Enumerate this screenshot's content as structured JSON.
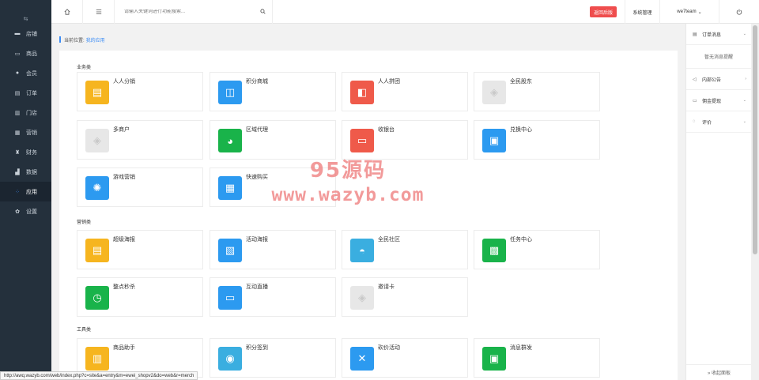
{
  "sidebar": {
    "collapse_icon": "collapse-icon",
    "items": [
      {
        "label": "店铺",
        "icon": "store-icon"
      },
      {
        "label": "商品",
        "icon": "goods-icon"
      },
      {
        "label": "会员",
        "icon": "member-icon"
      },
      {
        "label": "订单",
        "icon": "order-icon"
      },
      {
        "label": "门店",
        "icon": "shop-icon"
      },
      {
        "label": "营销",
        "icon": "marketing-icon"
      },
      {
        "label": "财务",
        "icon": "finance-icon"
      },
      {
        "label": "数据",
        "icon": "data-icon"
      },
      {
        "label": "应用",
        "icon": "apps-icon",
        "active": true
      },
      {
        "label": "设置",
        "icon": "settings-icon"
      }
    ]
  },
  "header": {
    "search_placeholder": "请输入关键词进行功能搜索...",
    "back_label": "返回后版",
    "system_label": "系统管理",
    "user_label": "we7team",
    "user_arrow": "⌄"
  },
  "breadcrumb": {
    "prefix": "当前位置:",
    "current": "我的应用"
  },
  "sections": [
    {
      "title": "业务类",
      "cards": [
        {
          "label": "人人分销",
          "color": "#f6b51f",
          "glyph": "▤"
        },
        {
          "label": "积分商城",
          "color": "#2c9af0",
          "glyph": "◫"
        },
        {
          "label": "人人拼团",
          "color": "#ef5a4a",
          "glyph": "◧"
        },
        {
          "label": "全民股东",
          "color": "#e7e7e7",
          "glyph": "◈"
        },
        {
          "label": "多商户",
          "color": "#e7e7e7",
          "glyph": "◈"
        },
        {
          "label": "区域代理",
          "color": "#19b34a",
          "glyph": "◕"
        },
        {
          "label": "收银台",
          "color": "#ef5a4a",
          "glyph": "▭"
        },
        {
          "label": "兑换中心",
          "color": "#2c9af0",
          "glyph": "▣"
        },
        {
          "label": "游戏营销",
          "color": "#2c9af0",
          "glyph": "✺"
        },
        {
          "label": "快速购买",
          "color": "#2c9af0",
          "glyph": "▦"
        }
      ]
    },
    {
      "title": "营销类",
      "cards": [
        {
          "label": "超级海报",
          "color": "#f6b51f",
          "glyph": "▤"
        },
        {
          "label": "活动海报",
          "color": "#2c9af0",
          "glyph": "▧"
        },
        {
          "label": "全民社区",
          "color": "#3aaee0",
          "glyph": "◓"
        },
        {
          "label": "任务中心",
          "color": "#19b34a",
          "glyph": "▩"
        },
        {
          "label": "整点秒杀",
          "color": "#19b34a",
          "glyph": "◷"
        },
        {
          "label": "互动直播",
          "color": "#2c9af0",
          "glyph": "▭"
        },
        {
          "label": "邀请卡",
          "color": "#e7e7e7",
          "glyph": "◈"
        }
      ]
    },
    {
      "title": "工具类",
      "cards": [
        {
          "label": "商品助手",
          "color": "#f6b51f",
          "glyph": "▥"
        },
        {
          "label": "积分签到",
          "color": "#3aaee0",
          "glyph": "◉"
        },
        {
          "label": "砍价活动",
          "color": "#2c9af0",
          "glyph": "✕"
        },
        {
          "label": "消息群发",
          "color": "#19b34a",
          "glyph": "▣"
        }
      ]
    }
  ],
  "right_panel": {
    "items": [
      {
        "label": "订单消息",
        "icon": "order-message-icon",
        "arrow": "⌄"
      },
      {
        "label": "内部公告",
        "icon": "announcement-icon",
        "arrow": "›"
      },
      {
        "label": "佣金提现",
        "icon": "withdraw-icon",
        "arrow": "⌄"
      },
      {
        "label": "评价",
        "icon": "review-icon",
        "arrow": "⌄"
      }
    ],
    "empty_text": "暂无消息提醒",
    "footer_label": "» 收起面板"
  },
  "watermark": {
    "cn": "95源码",
    "url": "www.wazyb.com"
  },
  "statusbar": {
    "url": "http://awq.wazyb.com/web/index.php?c=site&a=entry&m=ewei_shopv2&do=web&r=merch"
  }
}
